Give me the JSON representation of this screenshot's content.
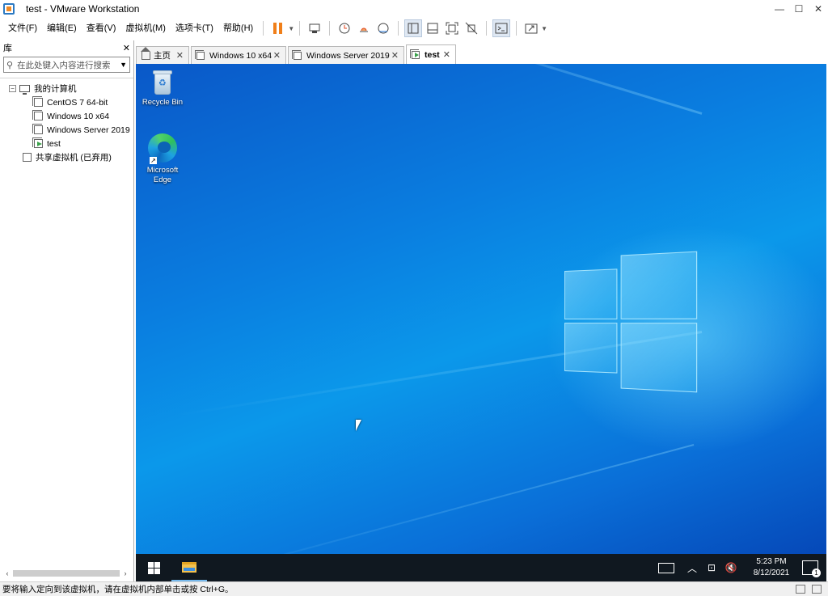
{
  "window": {
    "title": "test - VMware Workstation",
    "minimize": "—",
    "maximize": "☐",
    "close": "✕"
  },
  "menu": [
    "文件(F)",
    "编辑(E)",
    "查看(V)",
    "虚拟机(M)",
    "选项卡(T)",
    "帮助(H)"
  ],
  "library": {
    "title": "库",
    "close": "✕",
    "search_placeholder": "在此处键入内容进行搜索",
    "tree": {
      "root": "我的计算机",
      "expander": "−",
      "vms": [
        "CentOS 7 64-bit",
        "Windows 10 x64",
        "Windows Server 2019",
        "test"
      ],
      "shared": "共享虚拟机 (已弃用)"
    },
    "scroll_left": "‹",
    "scroll_right": "›"
  },
  "tabs": [
    {
      "label": "主页",
      "icon": "home-icon"
    },
    {
      "label": "Windows 10 x64",
      "icon": "vm-icon"
    },
    {
      "label": "Windows Server 2019",
      "icon": "vm-icon"
    },
    {
      "label": "test",
      "icon": "vm-running-icon",
      "active": true
    }
  ],
  "tab_close": "✕",
  "desktop": {
    "icons": [
      {
        "label": "Recycle Bin"
      },
      {
        "label": "Microsoft Edge"
      }
    ],
    "shortcut_arrow": "↗",
    "recycle_symbol": "♻"
  },
  "taskbar": {
    "time": "5:23 PM",
    "date": "8/12/2021",
    "chevron": "︿",
    "network": "⊡",
    "volume": "🔇",
    "notifications_count": "1"
  },
  "statusbar": {
    "text": "要将输入定向到该虚拟机，请在虚拟机内部单击或按 Ctrl+G。"
  },
  "colors": {
    "accent": "#f07f1a",
    "desktop_blue": "#0a7ee0",
    "taskbar": "#101820"
  }
}
